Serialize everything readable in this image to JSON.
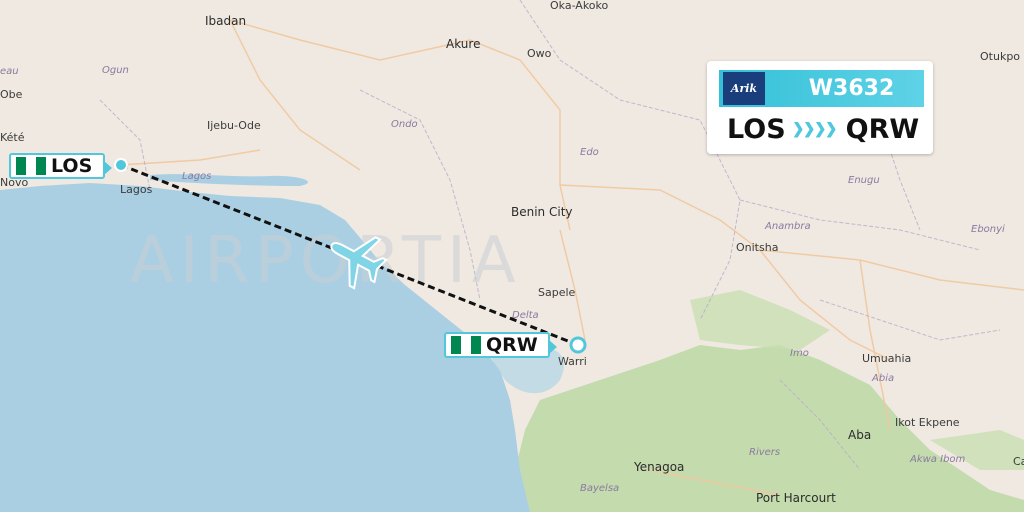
{
  "map": {
    "watermark": "AIRPORTIA",
    "cities": [
      {
        "name": "Ibadan"
      },
      {
        "name": "Oka-Akoko"
      },
      {
        "name": "Otukpo"
      },
      {
        "name": "Akure"
      },
      {
        "name": "Owo"
      },
      {
        "name": "Ijebu-Ode"
      },
      {
        "name": "Benin City"
      },
      {
        "name": "Onitsha"
      },
      {
        "name": "Sapele"
      },
      {
        "name": "Lagos"
      },
      {
        "name": "Warri"
      },
      {
        "name": "Umuahia"
      },
      {
        "name": "Aba"
      },
      {
        "name": "Ikot Ekpene"
      },
      {
        "name": "Yenagoa"
      },
      {
        "name": "Port Harcourt"
      },
      {
        "name": "Novo"
      },
      {
        "name": "Kété"
      },
      {
        "name": "Obe"
      },
      {
        "name": "Ca"
      }
    ],
    "regions": [
      {
        "name": "Ogun"
      },
      {
        "name": "Ondo"
      },
      {
        "name": "Edo"
      },
      {
        "name": "Enugu"
      },
      {
        "name": "Anambra"
      },
      {
        "name": "Ebonyi"
      },
      {
        "name": "Imo"
      },
      {
        "name": "Abia"
      },
      {
        "name": "Rivers"
      },
      {
        "name": "Akwa Ibom"
      },
      {
        "name": "Bayelsa"
      },
      {
        "name": "Delta"
      },
      {
        "name": "Lagos"
      },
      {
        "name": "eau"
      }
    ]
  },
  "origin": {
    "code": "LOS",
    "flag_colors": [
      "#008751",
      "#ffffff",
      "#008751"
    ]
  },
  "destination": {
    "code": "QRW",
    "flag_colors": [
      "#008751",
      "#ffffff",
      "#008751"
    ]
  },
  "flight_card": {
    "airline_logo_text": "Arik",
    "flight_number": "W3632",
    "from_code": "LOS",
    "to_code": "QRW",
    "accent_color": "#4fc8dd"
  },
  "plane_icon": "airplane-icon",
  "colors": {
    "land": "#efe9e1",
    "water": "#a9cfe3",
    "forest": "#b9d6a0",
    "route": "#111111"
  }
}
